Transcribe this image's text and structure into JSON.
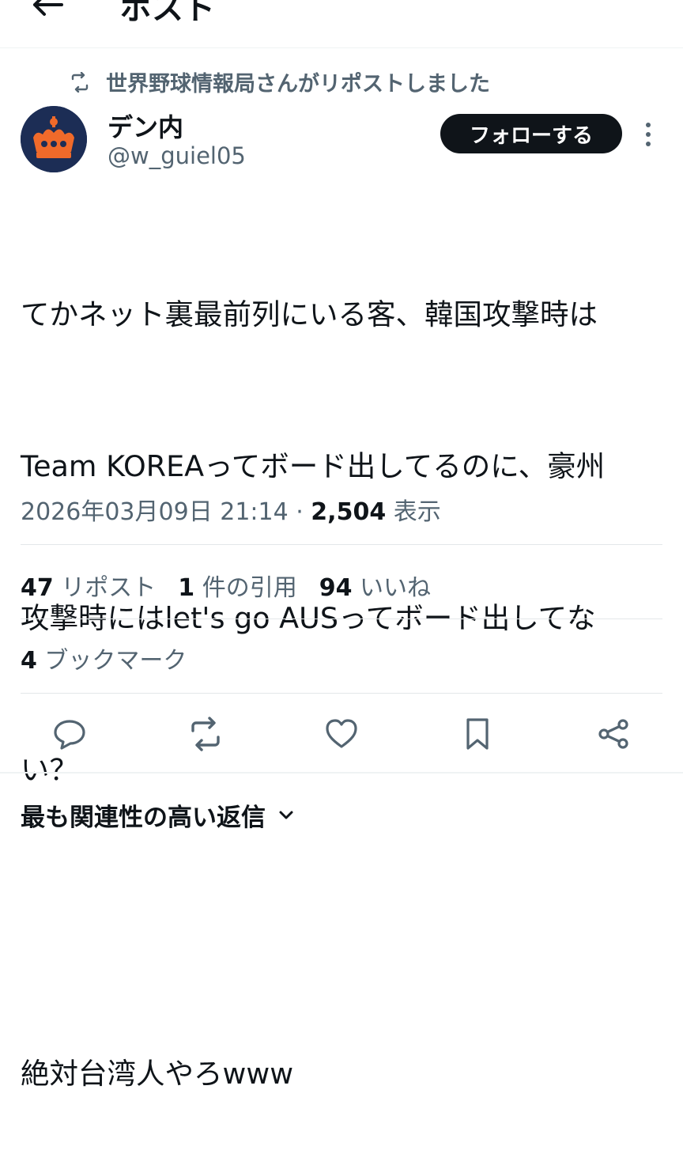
{
  "header": {
    "back_icon": "arrow-left-icon",
    "title": "ポスト"
  },
  "repost_notice": {
    "icon": "repost-icon",
    "text": "世界野球情報局さんがリポストしました"
  },
  "author": {
    "display_name": "デン内",
    "handle": "@w_guiel05",
    "avatar": "crown-avatar"
  },
  "follow_button": "フォローする",
  "more_icon": "more-vertical-icon",
  "tweet": {
    "lines": [
      "てかネット裏最前列にいる客、韓国攻撃時は",
      "Team KOREAってボード出してるのに、豪州",
      "攻撃時にはlet's go AUSってボード出してな",
      "い？",
      "絶対台湾人やろwww"
    ]
  },
  "meta": {
    "datetime": "2026年03月09日 21:14",
    "separator": " · ",
    "views": "2,504",
    "views_label": "表示"
  },
  "stats": {
    "reposts": "47",
    "reposts_label": "リポスト",
    "quotes": "1",
    "quotes_label": "件の引用",
    "likes": "94",
    "likes_label": "いいね",
    "bookmarks": "4",
    "bookmarks_label": "ブックマーク"
  },
  "actions": [
    "reply-icon",
    "repost-icon",
    "like-icon",
    "bookmark-icon",
    "share-icon"
  ],
  "replies_header": {
    "label": "最も関連性の高い返信",
    "icon": "chevron-down-icon"
  },
  "colors": {
    "text": "#0f1419",
    "secondary": "#536471",
    "divider": "#e3e7e9",
    "button_bg": "#0f1419"
  }
}
